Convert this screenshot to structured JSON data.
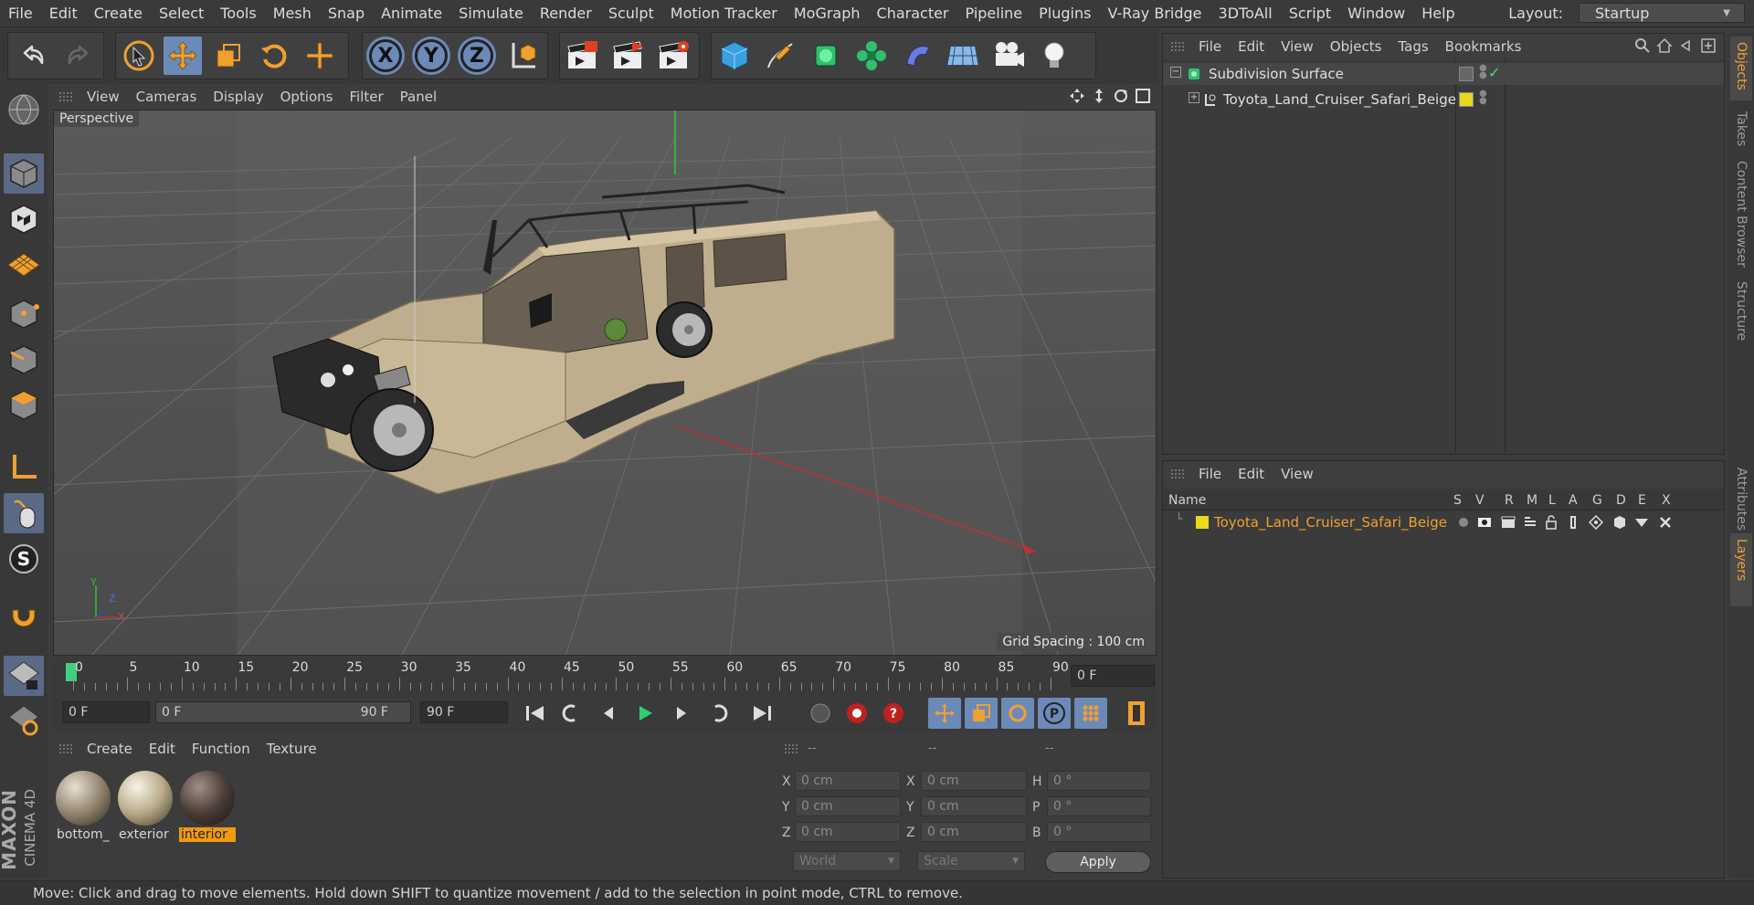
{
  "menubar": {
    "items": [
      "File",
      "Edit",
      "Create",
      "Select",
      "Tools",
      "Mesh",
      "Snap",
      "Animate",
      "Simulate",
      "Render",
      "Sculpt",
      "Motion Tracker",
      "MoGraph",
      "Character",
      "Pipeline",
      "Plugins",
      "V-Ray Bridge",
      "3DToAll",
      "Script",
      "Window",
      "Help"
    ],
    "layout_label": "Layout:",
    "layout_value": "Startup"
  },
  "toolbar": {
    "axis_x": "X",
    "axis_y": "Y",
    "axis_z": "Z"
  },
  "viewport": {
    "menu": [
      "View",
      "Cameras",
      "Display",
      "Options",
      "Filter",
      "Panel"
    ],
    "camera_label": "Perspective",
    "grid_spacing": "Grid Spacing : 100 cm",
    "axis_y": "Y",
    "axis_z": "Z",
    "axis_x": "X"
  },
  "timeline": {
    "ticks": [
      "0",
      "5",
      "10",
      "15",
      "20",
      "25",
      "30",
      "35",
      "40",
      "45",
      "50",
      "55",
      "60",
      "65",
      "70",
      "75",
      "80",
      "85",
      "90"
    ],
    "current_frame": "0 F"
  },
  "transport": {
    "start_field": "0 F",
    "range_start": "0 F",
    "range_end": "90 F",
    "end_field": "90 F"
  },
  "materials": {
    "menu": [
      "Create",
      "Edit",
      "Function",
      "Texture"
    ],
    "items": [
      {
        "name": "bottom_",
        "selected": false
      },
      {
        "name": "exterior",
        "selected": false
      },
      {
        "name": "interior",
        "selected": true
      }
    ]
  },
  "coordinates": {
    "headers": [
      "--",
      "--",
      "--"
    ],
    "rows": [
      {
        "l1": "X",
        "v1": "0 cm",
        "l2": "X",
        "v2": "0 cm",
        "l3": "H",
        "v3": "0 °"
      },
      {
        "l1": "Y",
        "v1": "0 cm",
        "l2": "Y",
        "v2": "0 cm",
        "l3": "P",
        "v3": "0 °"
      },
      {
        "l1": "Z",
        "v1": "0 cm",
        "l2": "Z",
        "v2": "0 cm",
        "l3": "B",
        "v3": "0 °"
      }
    ],
    "mode": "World",
    "scale": "Scale",
    "apply": "Apply"
  },
  "objects": {
    "menu": [
      "File",
      "Edit",
      "View",
      "Objects",
      "Tags",
      "Bookmarks"
    ],
    "tree": [
      {
        "name": "Subdivision Surface"
      },
      {
        "name": "Toyota_Land_Cruiser_Safari_Beige"
      }
    ]
  },
  "layers": {
    "menu": [
      "File",
      "Edit",
      "View"
    ],
    "name_header": "Name",
    "columns": [
      "S",
      "V",
      "R",
      "M",
      "L",
      "A",
      "G",
      "D",
      "E",
      "X"
    ],
    "row_name": "Toyota_Land_Cruiser_Safari_Beige"
  },
  "side_tabs": [
    {
      "label": "Objects",
      "active": true
    },
    {
      "label": "Takes",
      "active": false
    },
    {
      "label": "Content Browser",
      "active": false
    },
    {
      "label": "Structure",
      "active": false
    },
    {
      "label": "Attributes",
      "active": false
    },
    {
      "label": "Layers",
      "active": true
    }
  ],
  "branding": {
    "maxon": "MAXON",
    "product": "CINEMA 4D"
  },
  "status": "Move: Click and drag to move elements. Hold down SHIFT to quantize movement / add to the selection in point mode, CTRL to remove.",
  "colors": {
    "accent_orange": "#f09a10",
    "selection_blue": "#6c8ab8",
    "layer_yellow": "#e8d81e",
    "object_green": "#3ad28c"
  }
}
